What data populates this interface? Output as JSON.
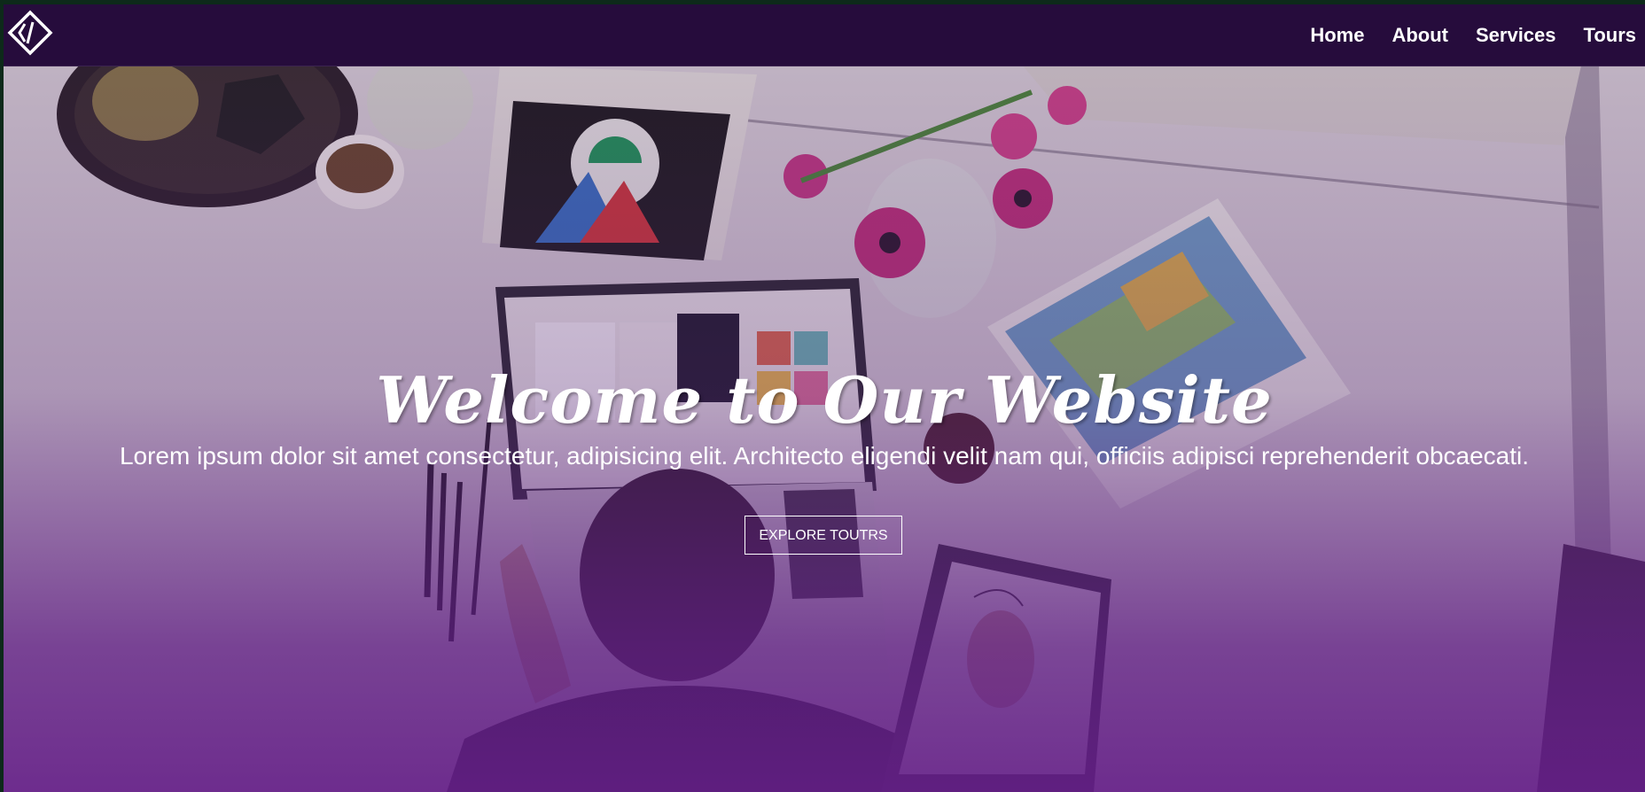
{
  "nav": {
    "logo_icon": "code-brackets-diamond-icon",
    "links": [
      "Home",
      "About",
      "Services",
      "Tours"
    ]
  },
  "hero": {
    "title": "Welcome to Our Website",
    "subtitle": "Lorem ipsum dolor sit amet consectetur, adipisicing elit. Architecto eligendi velit nam qui, officiis adipisci reprehenderit obcaecati.",
    "button_label": "EXPLORE TOUTRS"
  },
  "colors": {
    "navbar_bg": "#260c3c",
    "overlay": "#5f1e82",
    "text": "#ffffff"
  }
}
